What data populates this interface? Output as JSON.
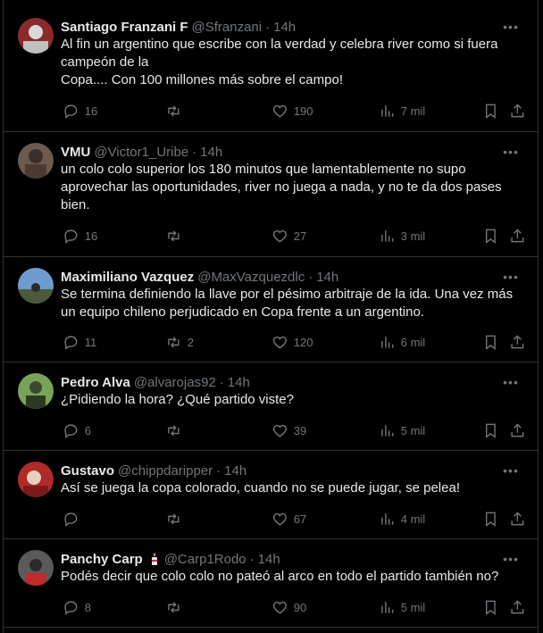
{
  "colors": {
    "background": "#000000",
    "text": "#e7e9ea",
    "muted": "#71767b",
    "border": "#2f3336"
  },
  "tweets": [
    {
      "name": "Santiago Franzani F",
      "handle": "@Sfranzani",
      "dot": "·",
      "time": "14h",
      "text": "Al fin un argentino que escribe con la verdad y celebra river como si fuera campeón de la\nCopa.... Con 100 millones más sobre el campo!",
      "replies": "16",
      "retweets": "",
      "likes": "190",
      "views": "7 mil",
      "avatar_colors": [
        "#8a2a2a",
        "#d9d9d9"
      ]
    },
    {
      "name": "VMU",
      "handle": "@Victor1_Uribe",
      "dot": "·",
      "time": "14h",
      "text": "un colo colo superior los 180 minutos que lamentablemente no supo aprovechar las oportunidades, river no juega a nada, y no te da dos pases bien.",
      "replies": "16",
      "retweets": "",
      "likes": "27",
      "views": "3 mil",
      "avatar_colors": [
        "#6b5a4e",
        "#3a2e28"
      ]
    },
    {
      "name": "Maximiliano Vazquez",
      "handle": "@MaxVazquezdlc",
      "dot": "·",
      "time": "14h",
      "text": "Se termina definiendo la llave por el pésimo arbitraje de la ida. Una vez más un equipo chileno perjudicado en Copa frente a un argentino.",
      "replies": "11",
      "retweets": "2",
      "likes": "120",
      "views": "6 mil",
      "avatar_colors": [
        "#6f9ccf",
        "#4a5a3a"
      ]
    },
    {
      "name": "Pedro Alva",
      "handle": "@alvarojas92",
      "dot": "·",
      "time": "14h",
      "text": "¿Pidiendo la hora? ¿Qué partido viste?",
      "replies": "6",
      "retweets": "",
      "likes": "39",
      "views": "5 mil",
      "avatar_colors": [
        "#7aa35a",
        "#3a4a2a"
      ]
    },
    {
      "name": "Gustavo",
      "handle": "@chippdaripper",
      "dot": "·",
      "time": "14h",
      "text": "Así se juega la copa colorado, cuando no se puede jugar, se pelea!",
      "replies": "",
      "retweets": "",
      "likes": "67",
      "views": "4 mil",
      "avatar_colors": [
        "#b02a2a",
        "#e8d0c0"
      ]
    },
    {
      "name": "Panchy Carp",
      "handle": "@Carp1Rodo",
      "dot": "·",
      "time": "14h",
      "text": "Podés decir que colo colo no pateó al arco en todo el partido también no?",
      "replies": "8",
      "retweets": "",
      "likes": "90",
      "views": "5 mil",
      "avatar_colors": [
        "#5a5a5a",
        "#c02a2a"
      ]
    }
  ]
}
